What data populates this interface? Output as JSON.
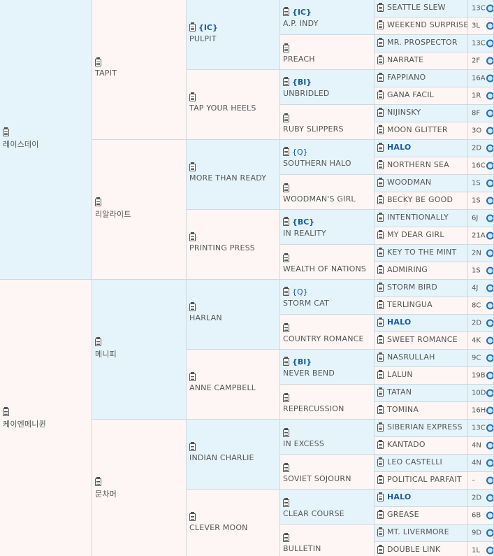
{
  "pedigree": {
    "g1": [
      {
        "name": "레이스데이",
        "bg": "blue"
      },
      {
        "name": "케이엔메니퀸",
        "bg": "pink"
      }
    ],
    "g2": [
      {
        "name": "TAPIT",
        "bg": "pink"
      },
      {
        "name": "리알라이트",
        "bg": "pink"
      },
      {
        "name": "메니피",
        "bg": "blue"
      },
      {
        "name": "문차머",
        "bg": "pink"
      }
    ],
    "g3": [
      {
        "name": "PULPIT",
        "tag": "{IC}",
        "bg": "blue"
      },
      {
        "name": "TAP YOUR HEELS",
        "bg": "pink"
      },
      {
        "name": "MORE THAN READY",
        "bg": "blue"
      },
      {
        "name": "PRINTING PRESS",
        "bg": "pink"
      },
      {
        "name": "HARLAN",
        "bg": "blue"
      },
      {
        "name": "ANNE CAMPBELL",
        "bg": "pink"
      },
      {
        "name": "INDIAN CHARLIE",
        "bg": "blue"
      },
      {
        "name": "CLEVER MOON",
        "bg": "pink"
      }
    ],
    "g4": [
      {
        "name": "A.P. INDY",
        "tag": "{IC}",
        "bg": "blue"
      },
      {
        "name": "PREACH",
        "bg": "pink"
      },
      {
        "name": "UNBRIDLED",
        "tag": "{BI}",
        "bg": "blue"
      },
      {
        "name": "RUBY SLIPPERS",
        "bg": "pink"
      },
      {
        "name": "SOUTHERN HALO",
        "tag": "{Q}",
        "bg": "blue"
      },
      {
        "name": "WOODMAN'S GIRL",
        "bg": "pink"
      },
      {
        "name": "IN REALITY",
        "tag": "{BC}",
        "bg": "blue"
      },
      {
        "name": "WEALTH OF NATIONS",
        "bg": "pink"
      },
      {
        "name": "STORM CAT",
        "tag": "{Q}",
        "bg": "blue"
      },
      {
        "name": "COUNTRY ROMANCE",
        "bg": "pink"
      },
      {
        "name": "NEVER BEND",
        "tag": "{BI}",
        "bg": "blue"
      },
      {
        "name": "REPERCUSSION",
        "bg": "pink"
      },
      {
        "name": "IN EXCESS",
        "bg": "blue"
      },
      {
        "name": "SOVIET SOJOURN",
        "bg": "pink"
      },
      {
        "name": "CLEAR COURSE",
        "bg": "blue"
      },
      {
        "name": "BULLETIN",
        "bg": "pink"
      }
    ],
    "g5": [
      {
        "name": "SEATTLE SLEW",
        "code": "13C"
      },
      {
        "name": "WEEKEND SURPRISE",
        "code": "3L"
      },
      {
        "name": "MR. PROSPECTOR",
        "code": "13C"
      },
      {
        "name": "NARRATE",
        "code": "2F"
      },
      {
        "name": "FAPPIANO",
        "code": "16A"
      },
      {
        "name": "GANA FACIL",
        "code": "1R"
      },
      {
        "name": "NIJINSKY",
        "code": "8F"
      },
      {
        "name": "MOON GLITTER",
        "code": "3O"
      },
      {
        "name": "HALO",
        "code": "2D",
        "bold": true
      },
      {
        "name": "NORTHERN SEA",
        "code": "16C"
      },
      {
        "name": "WOODMAN",
        "code": "1S"
      },
      {
        "name": "BECKY BE GOOD",
        "code": "1S"
      },
      {
        "name": "INTENTIONALLY",
        "code": "6J"
      },
      {
        "name": "MY DEAR GIRL",
        "code": "21A"
      },
      {
        "name": "KEY TO THE MINT",
        "code": "2N"
      },
      {
        "name": "ADMIRING",
        "code": "1S"
      },
      {
        "name": "STORM BIRD",
        "code": "4J"
      },
      {
        "name": "TERLINGUA",
        "code": "8C"
      },
      {
        "name": "HALO",
        "code": "2D",
        "bold": true
      },
      {
        "name": "SWEET ROMANCE",
        "code": "4K"
      },
      {
        "name": "NASRULLAH",
        "code": "9C"
      },
      {
        "name": "LALUN",
        "code": "19B"
      },
      {
        "name": "TATAN",
        "code": "10D"
      },
      {
        "name": "TOMINA",
        "code": "16H"
      },
      {
        "name": "SIBERIAN EXPRESS",
        "code": "13C"
      },
      {
        "name": "KANTADO",
        "code": "4N"
      },
      {
        "name": "LEO CASTELLI",
        "code": "4N"
      },
      {
        "name": "POLITICAL PARFAIT",
        "code": "–"
      },
      {
        "name": "HALO",
        "code": "2D",
        "bold": true
      },
      {
        "name": "GREASE",
        "code": "6B"
      },
      {
        "name": "MT. LIVERMORE",
        "code": "9D"
      },
      {
        "name": "DOUBLE LINK",
        "code": "1L"
      }
    ]
  },
  "icons": {
    "record": "clipboard-icon",
    "search": "magnifier-icon"
  }
}
